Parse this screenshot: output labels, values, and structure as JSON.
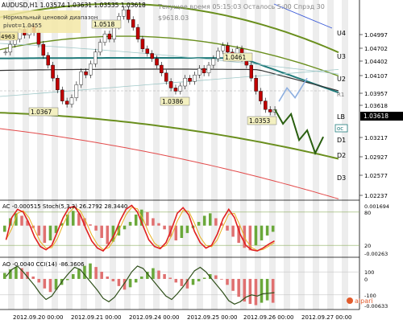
{
  "header": {
    "line1": "AUDUSD,H1  1.03574 1.03631 1.03535 1.03618",
    "line2": "Нормальный ценовой диапазон",
    "line3": "pivot=1.0455",
    "server_time": "Текущее время 05:15:03 Осталось 5:00 Спрэд 30",
    "balance": "$9618.03"
  },
  "price_levels": {
    "U4": "U4",
    "U3": "U3",
    "U2": "U2",
    "R1": "R1",
    "LB": "LB",
    "D1": "D1",
    "D2": "D2",
    "D3": "D3",
    "oc": "oc"
  },
  "annotations": {
    "high1": "1.0518",
    "high2": "1.0461",
    "low1": "1.0367",
    "low2": "1.0386",
    "low3": "1.0353",
    "tag_top_left": "4963"
  },
  "price_axis": [
    "1.04997",
    "1.04702",
    "1.04402",
    "1.04107",
    "1.03957",
    "1.03618",
    "1.03217",
    "1.02927",
    "1.02577",
    "1.02237"
  ],
  "current_price": "1.03618",
  "ac_panel": {
    "label": "AC -0.000515  Stoch(5,3,3) 26.2792 28.3440",
    "axis": [
      "0.001694",
      "80",
      "20",
      "-0.00263"
    ]
  },
  "ao_panel": {
    "label": "AO -0.0040  CCI(14) -86.3606",
    "axis": [
      "100",
      "0",
      "-100",
      "-0.00633"
    ]
  },
  "time_axis": [
    "2012.09.20 00:00",
    "2012.09.21 00:00",
    "2012.09.24 00:00",
    "2012.09.25 00:00",
    "2012.09.26 00:00",
    "2012.09.27 00:00"
  ],
  "watermark": "alpari",
  "colors": {
    "up_candle": "#ffffff",
    "down_candle": "#c00000",
    "ma_green": "#6a8f1e",
    "ma_teal": "#1f7a7a",
    "ma_dark": "#333333",
    "band_red": "#e24b4b",
    "blue_line": "#3b5bd9",
    "osc_red": "#e02020",
    "osc_green": "#3a8a1a",
    "bg_stripe": "#d8d8d8"
  },
  "chart_data": {
    "type": "candlestick",
    "symbol": "AUDUSD",
    "timeframe": "H1",
    "ylim": [
      1.0224,
      1.053
    ],
    "ohlc_close_series": [
      1.045,
      1.0462,
      1.047,
      1.0485,
      1.0476,
      1.049,
      1.048,
      1.0462,
      1.0445,
      1.043,
      1.041,
      1.0392,
      1.0375,
      1.037,
      1.038,
      1.04,
      1.042,
      1.0415,
      1.0432,
      1.045,
      1.0465,
      1.0478,
      1.047,
      1.049,
      1.0505,
      1.0515,
      1.05,
      1.0488,
      1.047,
      1.0455,
      1.0448,
      1.044,
      1.043,
      1.0418,
      1.0405,
      1.0395,
      1.039,
      1.0398,
      1.041,
      1.0405,
      1.0415,
      1.0425,
      1.0418,
      1.043,
      1.044,
      1.0452,
      1.046,
      1.045,
      1.0445,
      1.0455,
      1.044,
      1.043,
      1.041,
      1.039,
      1.0375,
      1.0362,
      1.0358,
      1.0362
    ],
    "forecast_path": [
      1.0362,
      1.034,
      1.0355,
      1.0315,
      1.033,
      1.0295,
      1.032
    ],
    "ac_values": [
      -0.0005,
      0.0006,
      0.001,
      0.0008,
      0.0004,
      -0.0002,
      -0.0008,
      -0.0014,
      -0.0012,
      -0.0006,
      0.0002,
      0.0009,
      0.0012,
      0.001,
      0.0006,
      0.0001,
      -0.0004,
      -0.001,
      -0.0015,
      -0.0013,
      -0.0008,
      -0.0003,
      0.0003,
      0.0009,
      0.0013,
      0.0011,
      0.0006,
      0.0002,
      -0.0003,
      -0.0009,
      -0.0012,
      -0.001,
      -0.0006,
      -0.0002,
      0.0003,
      0.0008,
      0.001,
      0.0006,
      0.0002,
      -0.0004,
      -0.0009,
      -0.0014,
      -0.0018,
      -0.002,
      -0.0016,
      -0.0012,
      -0.0008,
      -0.0005
    ],
    "stoch_values": [
      30,
      70,
      85,
      80,
      60,
      35,
      18,
      12,
      20,
      45,
      70,
      88,
      90,
      75,
      50,
      28,
      15,
      10,
      22,
      40,
      65,
      85,
      92,
      80,
      55,
      30,
      18,
      14,
      25,
      50,
      78,
      88,
      75,
      45,
      25,
      15,
      20,
      40,
      68,
      85,
      70,
      40,
      20,
      12,
      10,
      15,
      22,
      28
    ],
    "ao_values": [
      0.001,
      0.0016,
      0.002,
      0.0018,
      0.0012,
      0.0004,
      -0.0006,
      -0.0016,
      -0.0022,
      -0.0018,
      -0.001,
      -0.0002,
      0.0008,
      0.0016,
      0.0022,
      0.0026,
      0.002,
      0.0012,
      0.0004,
      -0.0004,
      -0.0012,
      -0.0018,
      -0.0014,
      -0.0006,
      0.0004,
      0.0012,
      0.0018,
      0.0014,
      0.0008,
      0.0002,
      -0.0006,
      -0.0012,
      -0.0016,
      -0.001,
      -0.0004,
      0.0002,
      0.0008,
      0.0006,
      0.0,
      -0.001,
      -0.002,
      -0.003,
      -0.0038,
      -0.0042,
      -0.0044,
      -0.004,
      -0.0036,
      -0.004
    ],
    "cci_values": [
      60,
      120,
      150,
      100,
      40,
      -20,
      -90,
      -140,
      -110,
      -40,
      30,
      90,
      140,
      120,
      60,
      0,
      -60,
      -130,
      -160,
      -120,
      -50,
      20,
      100,
      150,
      130,
      70,
      10,
      -50,
      -110,
      -140,
      -90,
      -30,
      40,
      110,
      140,
      100,
      40,
      -20,
      -80,
      -150,
      -180,
      -160,
      -120,
      -100,
      -110,
      -90,
      -86,
      -80
    ]
  }
}
